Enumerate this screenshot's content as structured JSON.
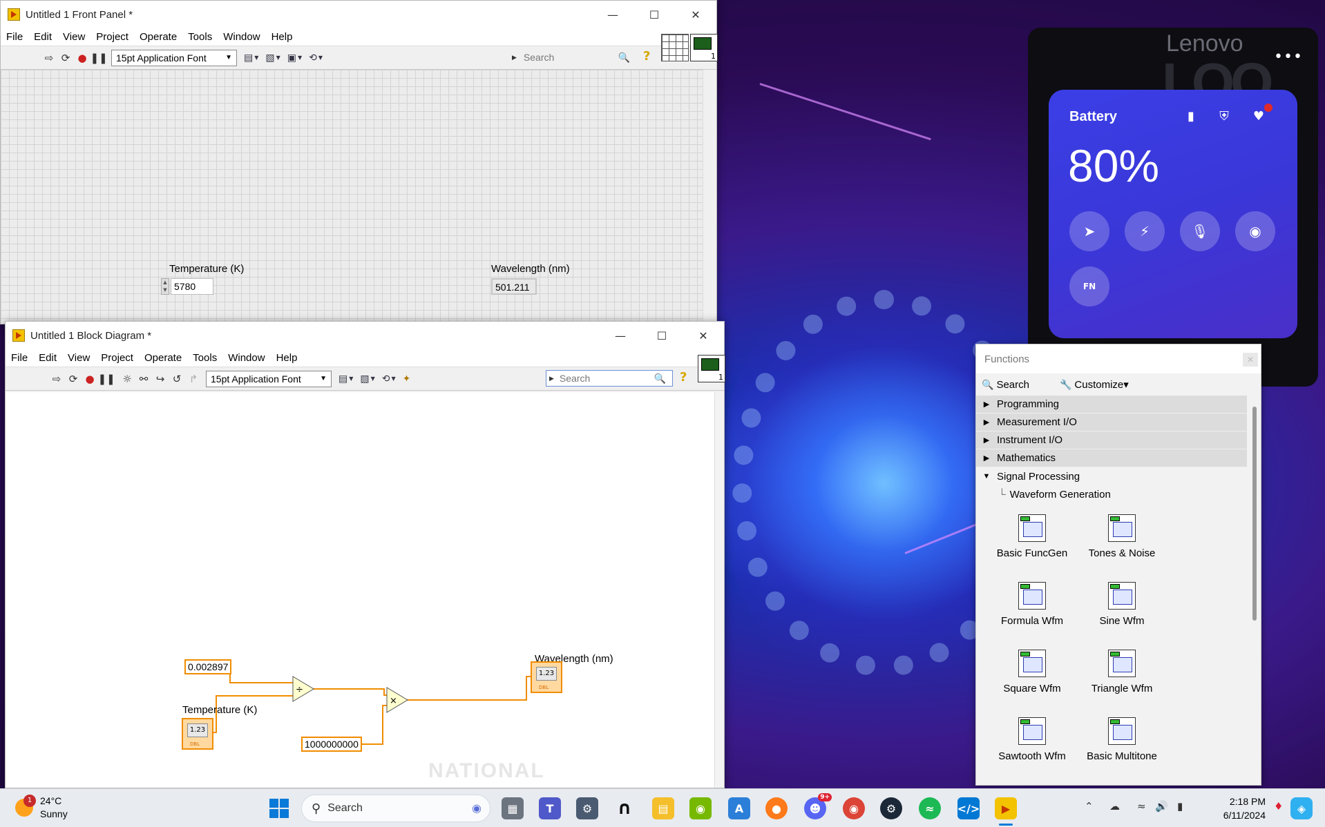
{
  "front_panel": {
    "title": "Untitled 1 Front Panel *",
    "menu": [
      "File",
      "Edit",
      "View",
      "Project",
      "Operate",
      "Tools",
      "Window",
      "Help"
    ],
    "font_select": "15pt Application Font",
    "search_placeholder": "Search",
    "temperature_label": "Temperature (K)",
    "temperature_value": "5780",
    "wavelength_label": "Wavelength (nm)",
    "wavelength_value": "501.211"
  },
  "block_diagram": {
    "title": "Untitled 1 Block Diagram *",
    "menu": [
      "File",
      "Edit",
      "View",
      "Project",
      "Operate",
      "Tools",
      "Window",
      "Help"
    ],
    "font_select": "15pt Application Font",
    "search_placeholder": "Search",
    "constant_wien": "0.002897",
    "constant_scale": "1000000000",
    "temperature_label": "Temperature (K)",
    "wavelength_label": "Wavelength (nm)",
    "terminal_text": "1.23",
    "terminal_type": "DBL",
    "divide_symbol": "÷",
    "multiply_symbol": "×",
    "watermark": "NATIONAL"
  },
  "functions_palette": {
    "title": "Functions",
    "search_label": "Search",
    "customize_label": "Customize▾",
    "categories": [
      {
        "label": "Programming",
        "state": "closed"
      },
      {
        "label": "Measurement I/O",
        "state": "closed"
      },
      {
        "label": "Instrument I/O",
        "state": "closed"
      },
      {
        "label": "Mathematics",
        "state": "closed"
      },
      {
        "label": "Signal Processing",
        "state": "open"
      }
    ],
    "subcategory": "Waveform Generation",
    "vis": [
      "Basic FuncGen",
      "Tones & Noise",
      "Formula Wfm",
      "Sine Wfm",
      "Square Wfm",
      "Triangle Wfm",
      "Sawtooth Wfm",
      "Basic Multitone"
    ]
  },
  "lenovo": {
    "brand": "Lenovo",
    "big_text": "LOQ",
    "more": "•••",
    "battery_title": "Battery",
    "battery_percent": "80%",
    "fn_label": "FN"
  },
  "taskbar": {
    "weather_temp": "24°C",
    "weather_desc": "Sunny",
    "weather_badge": "1",
    "search_label": "Search",
    "discord_badge": "9+",
    "time": "2:18 PM",
    "date": "6/11/2024"
  },
  "colors": {
    "wire": "#f08c00",
    "battery_panel": "#3b3fe6",
    "start_blue": "#0a7ad8"
  }
}
